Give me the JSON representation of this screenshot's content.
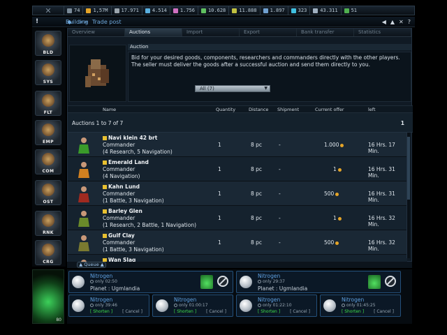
{
  "resources": [
    {
      "icon": "population-icon",
      "value": "74",
      "color": "#7a8a98"
    },
    {
      "icon": "credits-icon",
      "value": "1,57M",
      "color": "#e4a428"
    },
    {
      "icon": "metal-icon",
      "value": "17.971",
      "color": "#9aa4ac"
    },
    {
      "icon": "crystal-icon",
      "value": "4.514",
      "color": "#5ab0e0"
    },
    {
      "icon": "gas-icon",
      "value": "1.756",
      "color": "#d070c0"
    },
    {
      "icon": "fuel-icon",
      "value": "10.628",
      "color": "#60c060"
    },
    {
      "icon": "energy-icon",
      "value": "11.888",
      "color": "#c0c040"
    },
    {
      "icon": "research-icon",
      "value": "1.897",
      "color": "#70a0d0"
    },
    {
      "icon": "gem-icon",
      "value": "323",
      "color": "#40c0e0"
    },
    {
      "icon": "coins-icon",
      "value": "43.311",
      "color": "#a0b0c0"
    },
    {
      "icon": "cycle-icon",
      "value": "51",
      "color": "#50b050"
    }
  ],
  "breadcrumb": {
    "section": "Building",
    "sep": ">>",
    "page": "Trade post"
  },
  "sidebar": [
    {
      "label": "BLD",
      "icon": "building-icon"
    },
    {
      "label": "SYS",
      "icon": "system-icon"
    },
    {
      "label": "FLT",
      "icon": "fleet-icon"
    },
    {
      "label": "EMP",
      "icon": "empire-icon"
    },
    {
      "label": "COM",
      "icon": "commander-icon"
    },
    {
      "label": "OST",
      "icon": "station-icon"
    },
    {
      "label": "RNK",
      "icon": "rank-icon"
    },
    {
      "label": "CRG",
      "icon": "cargo-icon"
    }
  ],
  "tabs": [
    "Overview",
    "Auctions",
    "Import",
    "Export",
    "Bank transfer",
    "Statistics"
  ],
  "auction": {
    "title": "Auction",
    "description": "Bid for your desired goods, components, researchers and commanders directly with the other players. The seller must deliver the goods after a successful auction and send them directly to you.",
    "filter": "All (7)"
  },
  "columns": [
    "Name",
    "Quantity",
    "Distance",
    "Shipment",
    "Current offer",
    "left"
  ],
  "count": {
    "label": "Auctions 1 to 7 of 7",
    "page": "1"
  },
  "rows": [
    {
      "name": "Navi klein 42 brt",
      "type": "Commander",
      "skills": "(4 Research, 5 Navigation)",
      "qty": "1",
      "dist": "8 pc",
      "ship": "-",
      "offer": "1.000",
      "left": "16 Hrs. 17 Min.",
      "color": "#3a9a2a"
    },
    {
      "name": "Emerald Land",
      "type": "Commander",
      "skills": "(4 Navigation)",
      "qty": "1",
      "dist": "8 pc",
      "ship": "-",
      "offer": "1",
      "left": "16 Hrs. 31 Min.",
      "color": "#d08020"
    },
    {
      "name": "Kahn Lund",
      "type": "Commander",
      "skills": "(1 Battle, 3 Navigation)",
      "qty": "1",
      "dist": "8 pc",
      "ship": "-",
      "offer": "500",
      "left": "16 Hrs. 31 Min.",
      "color": "#a02a20"
    },
    {
      "name": "Barley Glen",
      "type": "Commander",
      "skills": "(1 Research, 2 Battle, 1 Navigation)",
      "qty": "1",
      "dist": "8 pc",
      "ship": "-",
      "offer": "1",
      "left": "16 Hrs. 32 Min.",
      "color": "#6a8a2a"
    },
    {
      "name": "Gulf Clay",
      "type": "Commander",
      "skills": "(1 Battle, 3 Navigation)",
      "qty": "1",
      "dist": "8 pc",
      "ship": "-",
      "offer": "500",
      "left": "16 Hrs. 32 Min.",
      "color": "#7a7a30"
    },
    {
      "name": "Wan Slag",
      "type": "",
      "skills": "",
      "qty": "",
      "dist": "",
      "ship": "",
      "offer": "",
      "left": "",
      "color": "#4a6a7a"
    }
  ],
  "queue": {
    "label": "Queue",
    "level": "80",
    "cards": [
      {
        "name": "Nitrogen",
        "time": "only 02:50",
        "planet": "Planet : Ugmlandia",
        "wide": true
      },
      {
        "name": "Nitrogen",
        "time": "only 29:37",
        "planet": "Planet : Ugmlandia",
        "wide": true
      },
      {
        "name": "Nitrogen",
        "time": "only 39:46",
        "shorten": "[ Shorten ]",
        "cancel": "[ Cancel ]"
      },
      {
        "name": "Nitrogen",
        "time": "only 01:00:17",
        "shorten": "[ Shorten ]",
        "cancel": "[ Cancel ]"
      },
      {
        "name": "Nitrogen",
        "time": "only 01:22:10",
        "shorten": "[ Shorten ]",
        "cancel": "[ Cancel ]"
      },
      {
        "name": "Nitrogen",
        "time": "only 01:45:25",
        "shorten": "[ Shorten ]",
        "cancel": "[ Cancel ]"
      }
    ]
  }
}
